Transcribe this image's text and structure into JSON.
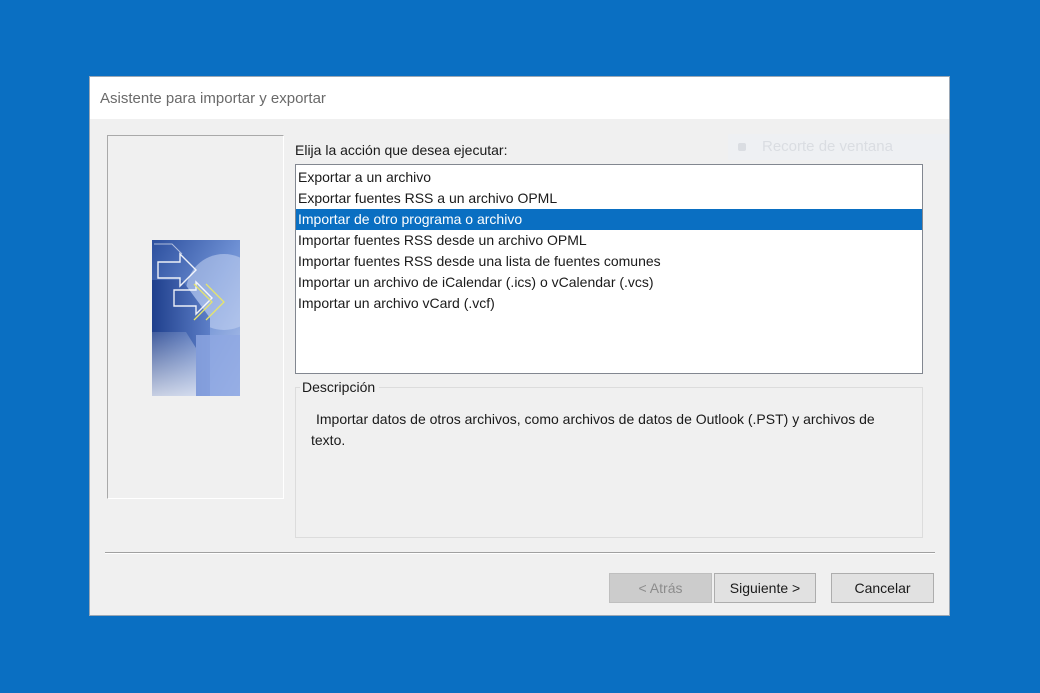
{
  "dialog": {
    "title": "Asistente para importar y exportar"
  },
  "ghost_overlay": {
    "label": "Recorte de ventana"
  },
  "main": {
    "prompt": "Elija la acción que desea ejecutar:",
    "actions": [
      {
        "label": "Exportar a un archivo",
        "selected": false
      },
      {
        "label": "Exportar fuentes RSS a un archivo OPML",
        "selected": false
      },
      {
        "label": "Importar de otro programa o archivo",
        "selected": true
      },
      {
        "label": "Importar fuentes RSS desde un archivo OPML",
        "selected": false
      },
      {
        "label": "Importar fuentes RSS desde una lista de fuentes comunes",
        "selected": false
      },
      {
        "label": "Importar un archivo de iCalendar (.ics) o vCalendar (.vcs)",
        "selected": false
      },
      {
        "label": "Importar un archivo vCard (.vcf)",
        "selected": false
      }
    ],
    "description_legend": "Descripción",
    "description_text": "Importar datos de otros archivos, como archivos de datos de Outlook (.PST) y archivos de texto."
  },
  "buttons": {
    "back": "< Atrás",
    "next": "Siguiente >",
    "cancel": "Cancelar"
  },
  "colors": {
    "desktop": "#0a6fc2",
    "selection": "#0a6fc2",
    "dialog_bg": "#f0f0f0"
  }
}
